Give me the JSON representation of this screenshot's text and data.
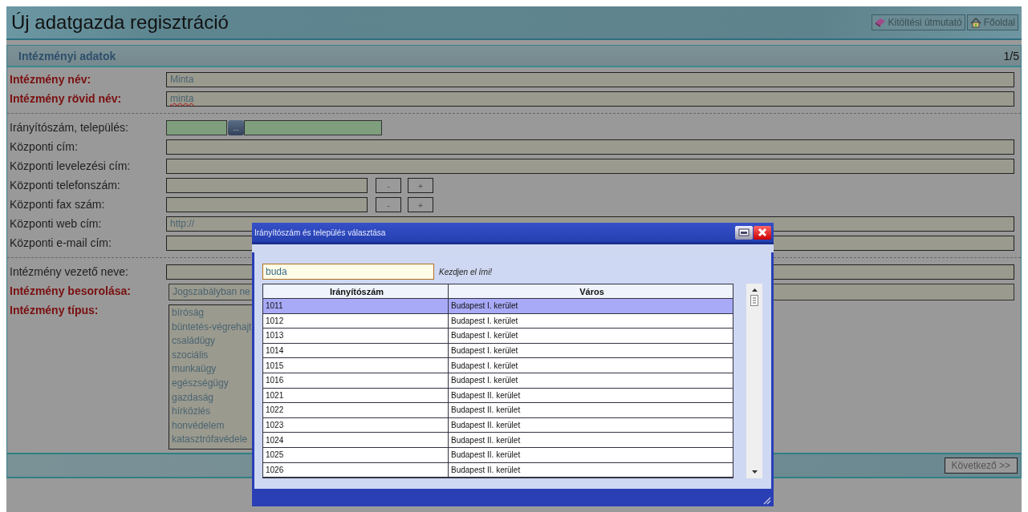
{
  "header": {
    "title": "Új adatgazda regisztráció",
    "links": [
      {
        "kind": "guide",
        "label": "Kitöltési útmutató"
      },
      {
        "kind": "home",
        "label": "Főoldal"
      }
    ]
  },
  "section": {
    "title": "Intézményi adatok",
    "step": "1/5"
  },
  "groups": [
    [
      {
        "label": "Intézmény név:",
        "required": true,
        "kind": "text",
        "value": "Minta"
      },
      {
        "label": "Intézmény rövid név:",
        "required": true,
        "kind": "text",
        "value": "minta",
        "misspelled": true
      }
    ],
    [
      {
        "label": "Irányítószám, település:",
        "required": false,
        "kind": "zip",
        "button": "..."
      },
      {
        "label": "Központi cím:",
        "required": false,
        "kind": "text"
      },
      {
        "label": "Központi levelezési cím:",
        "required": false,
        "kind": "text"
      },
      {
        "label": "Központi telefonszám:",
        "required": false,
        "kind": "phone",
        "buttons": [
          "-",
          "+"
        ]
      },
      {
        "label": "Központi fax szám:",
        "required": false,
        "kind": "phone",
        "buttons": [
          "-",
          "+"
        ]
      },
      {
        "label": "Központi web cím:",
        "required": false,
        "kind": "text",
        "value": "http://"
      },
      {
        "label": "Központi e-mail cím:",
        "required": false,
        "kind": "text"
      }
    ],
    [
      {
        "label": "Intézmény vezető neve:",
        "required": false,
        "kind": "text"
      },
      {
        "label": "Intézmény besorolása:",
        "required": true,
        "kind": "select",
        "value": "Jogszabályban ne"
      },
      {
        "label": "Intézmény típus:",
        "required": true,
        "kind": "list",
        "items": [
          "bíróság",
          "büntetés-végrehajt",
          "családügy",
          "szociális",
          "munkaügy",
          "egészségügy",
          "gazdaság",
          "hírközlés",
          "honvédelem",
          "katasztrófavédele"
        ]
      }
    ]
  ],
  "next_button": "Következő >>",
  "dialog": {
    "title": "Irányítószám és település választása",
    "search": {
      "value": "buda"
    },
    "hint": "Kezdjen el írni!",
    "columns": [
      "Irányítószám",
      "Város"
    ],
    "rows": [
      {
        "cells": [
          "1011",
          "Budapest I. kerület"
        ],
        "selected": true
      },
      {
        "cells": [
          "1012",
          "Budapest I. kerület"
        ],
        "selected": false
      },
      {
        "cells": [
          "1013",
          "Budapest I. kerület"
        ],
        "selected": false
      },
      {
        "cells": [
          "1014",
          "Budapest I. kerület"
        ],
        "selected": false
      },
      {
        "cells": [
          "1015",
          "Budapest I. kerület"
        ],
        "selected": false
      },
      {
        "cells": [
          "1016",
          "Budapest I. kerület"
        ],
        "selected": false
      },
      {
        "cells": [
          "1021",
          "Budapest II. kerület"
        ],
        "selected": false
      },
      {
        "cells": [
          "1022",
          "Budapest II. kerület"
        ],
        "selected": false
      },
      {
        "cells": [
          "1023",
          "Budapest II. kerület"
        ],
        "selected": false
      },
      {
        "cells": [
          "1024",
          "Budapest II. kerület"
        ],
        "selected": false
      },
      {
        "cells": [
          "1025",
          "Budapest II. kerület"
        ],
        "selected": false
      },
      {
        "cells": [
          "1026",
          "Budapest II. kerület"
        ],
        "selected": false
      }
    ]
  }
}
